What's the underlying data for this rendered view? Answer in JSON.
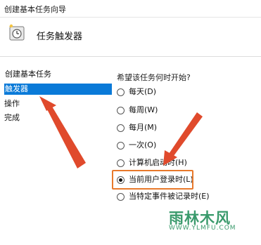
{
  "window": {
    "title": "创建基本任务向导"
  },
  "header": {
    "title": "任务触发器",
    "icon": "clock-wizard-icon"
  },
  "steps": [
    {
      "label": "创建基本任务"
    },
    {
      "label": "触发器"
    },
    {
      "label": "操作"
    },
    {
      "label": "完成"
    }
  ],
  "main": {
    "question": "希望该任务何时开始?",
    "options": [
      {
        "label": "每天(D)",
        "checked": false
      },
      {
        "label": "每周(W)",
        "checked": false
      },
      {
        "label": "每月(M)",
        "checked": false
      },
      {
        "label": "一次(O)",
        "checked": false
      },
      {
        "label": "计算机启动时(H)",
        "checked": false
      },
      {
        "label": "当前用户登录时(L)",
        "checked": true
      },
      {
        "label": "当特定事件被记录时(E)",
        "checked": false
      }
    ]
  },
  "watermark": {
    "logo_text": "雨林木风",
    "url": "WWW.YLMFU.COM"
  },
  "colors": {
    "selection": "#0a7ad8",
    "annotation": "#e8792b",
    "arrow": "#e04a2c"
  }
}
